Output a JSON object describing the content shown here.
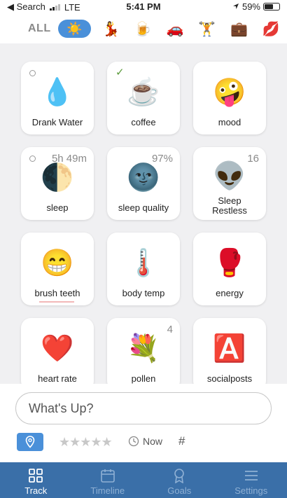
{
  "status_bar": {
    "back_label": "◀ Search",
    "network": "LTE",
    "time": "5:41 PM",
    "battery_percent": "59%",
    "battery_level": 0.59
  },
  "categories": {
    "all_label": "ALL",
    "selected": "☀️",
    "items": [
      "💃",
      "🍺",
      "🚗",
      "🏋️",
      "💼",
      "💋"
    ]
  },
  "trackers": [
    {
      "emoji": "💧",
      "label": "Drank Water",
      "value": "",
      "indicator": "circle"
    },
    {
      "emoji": "☕",
      "label": "coffee",
      "value": "",
      "indicator": "check"
    },
    {
      "emoji": "🤪",
      "label": "mood",
      "value": "",
      "indicator": ""
    },
    {
      "emoji": "🌓",
      "label": "sleep",
      "value": "5h 49m",
      "indicator": "circle"
    },
    {
      "emoji": "🌚",
      "label": "sleep quality",
      "value": "97%",
      "indicator": ""
    },
    {
      "emoji": "👽",
      "label": "Sleep Restless",
      "value": "16",
      "indicator": ""
    },
    {
      "emoji": "😁",
      "label": "brush teeth",
      "value": "",
      "indicator": ""
    },
    {
      "emoji": "🌡️",
      "label": "body temp",
      "value": "",
      "indicator": ""
    },
    {
      "emoji": "🥊",
      "label": "energy",
      "value": "",
      "indicator": ""
    },
    {
      "emoji": "❤️",
      "label": "heart rate",
      "value": "",
      "indicator": ""
    },
    {
      "emoji": "💐",
      "label": "pollen",
      "value": "4",
      "indicator": ""
    },
    {
      "emoji": "🅰️",
      "label": "socialposts",
      "value": "",
      "indicator": ""
    }
  ],
  "composer": {
    "placeholder": "What's Up?",
    "stars": "★★★★★",
    "time_label": "Now",
    "tag_label": "#"
  },
  "tabs": [
    {
      "label": "Track",
      "icon": "grid-icon",
      "active": true
    },
    {
      "label": "Timeline",
      "icon": "calendar-icon",
      "active": false
    },
    {
      "label": "Goals",
      "icon": "award-icon",
      "active": false
    },
    {
      "label": "Settings",
      "icon": "menu-icon",
      "active": false
    }
  ],
  "colors": {
    "accent": "#4a90d9",
    "tabbar": "#3a6fa8",
    "check": "#5a9a3a"
  }
}
